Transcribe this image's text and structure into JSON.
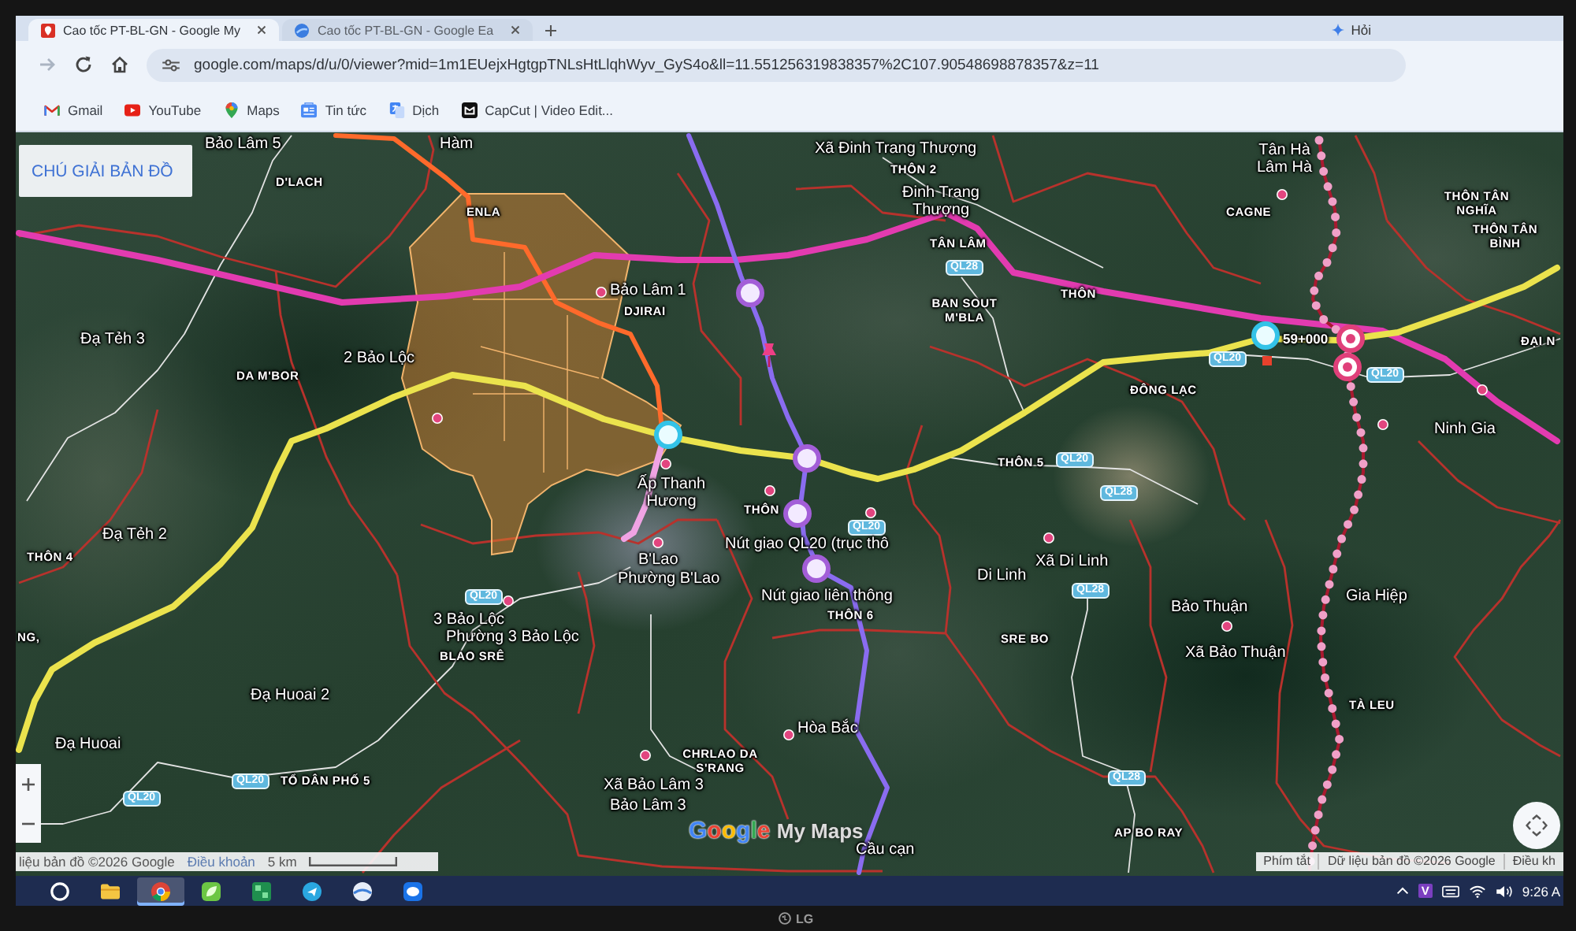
{
  "browser": {
    "tabs": [
      {
        "title": "Cao tốc PT-BL-GN - Google My",
        "selected": true
      },
      {
        "title": "Cao tốc PT-BL-GN - Google Ea",
        "selected": false
      }
    ],
    "assistant_button": "Hỏi",
    "forward_button": {
      "disabled": true
    },
    "url": "google.com/maps/d/u/0/viewer?mid=1m1EUejxHgtgpTNLsHtLlqhWyv_GyS4o&ll=11.551256319838357%2C107.90548698878357&z=11",
    "bookmarks": [
      {
        "label": "Gmail",
        "kind": "gmail"
      },
      {
        "label": "YouTube",
        "kind": "youtube"
      },
      {
        "label": "Maps",
        "kind": "maps"
      },
      {
        "label": "Tin tức",
        "kind": "news"
      },
      {
        "label": "Dịch",
        "kind": "translate"
      },
      {
        "label": "CapCut | Video Edit...",
        "kind": "capcut"
      }
    ]
  },
  "map": {
    "legend_button": "CHÚ GIẢI BẢN ĐỒ",
    "labels": [
      {
        "text": "Bảo Lâm 5",
        "kind": "place"
      },
      {
        "text": "Hàm",
        "kind": "place"
      },
      {
        "text": "Xã Đinh Trang Thượng",
        "kind": "place"
      },
      {
        "text": "THÔN 2",
        "kind": "hamlet"
      },
      {
        "text": "Tân Hà Lâm Hà",
        "kind": "place"
      },
      {
        "text": "D'LACH",
        "kind": "hamlet"
      },
      {
        "text": "ENLA",
        "kind": "hamlet"
      },
      {
        "text": "Đinh Trang Thượng",
        "kind": "place"
      },
      {
        "text": "CAGNE",
        "kind": "hamlet"
      },
      {
        "text": "THÔN TÂN NGHĨA",
        "kind": "hamlet"
      },
      {
        "text": "TÂN LÂM",
        "kind": "hamlet"
      },
      {
        "text": "THÔN TÂN BÌNH",
        "kind": "hamlet"
      },
      {
        "text": "QL28",
        "kind": "road"
      },
      {
        "text": "Bảo Lâm 1",
        "kind": "place"
      },
      {
        "text": "THÔN",
        "kind": "hamlet"
      },
      {
        "text": "DJIRAI",
        "kind": "hamlet"
      },
      {
        "text": "BAN SOUT M'BLA",
        "kind": "hamlet"
      },
      {
        "text": "Đạ Tẻh 3",
        "kind": "place"
      },
      {
        "text": "59+000",
        "kind": "km"
      },
      {
        "text": "ĐẠI N",
        "kind": "hamlet"
      },
      {
        "text": "2 Bảo Lộc",
        "kind": "place"
      },
      {
        "text": "QL20",
        "kind": "road"
      },
      {
        "text": "DA M'BOR",
        "kind": "hamlet"
      },
      {
        "text": "QL20",
        "kind": "road"
      },
      {
        "text": "ĐÔNG LẠC",
        "kind": "hamlet"
      },
      {
        "text": "Ninh Gia",
        "kind": "place"
      },
      {
        "text": "THÔN 5",
        "kind": "hamlet"
      },
      {
        "text": "QL20",
        "kind": "road"
      },
      {
        "text": "Ấp Thanh Hương",
        "kind": "place"
      },
      {
        "text": "QL28",
        "kind": "road"
      },
      {
        "text": "THÔN",
        "kind": "hamlet"
      },
      {
        "text": "Đạ Tẻh 2",
        "kind": "place"
      },
      {
        "text": "QL20",
        "kind": "road"
      },
      {
        "text": "Nút giao QL20 (trục thô",
        "kind": "place"
      },
      {
        "text": "THÔN 4",
        "kind": "hamlet"
      },
      {
        "text": "B'Lao",
        "kind": "place"
      },
      {
        "text": "Xã Di Linh",
        "kind": "place"
      },
      {
        "text": "Phường B'Lao",
        "kind": "place"
      },
      {
        "text": "Di Linh",
        "kind": "place"
      },
      {
        "text": "QL20",
        "kind": "road"
      },
      {
        "text": "Nút giao liên thông",
        "kind": "place"
      },
      {
        "text": "QL28",
        "kind": "road"
      },
      {
        "text": "Gia Hiệp",
        "kind": "place"
      },
      {
        "text": "THÔN 6",
        "kind": "hamlet"
      },
      {
        "text": "Bảo Thuận",
        "kind": "place"
      },
      {
        "text": "3 Bảo Lộc",
        "kind": "place"
      },
      {
        "text": "NG,",
        "kind": "hamlet"
      },
      {
        "text": "Phường 3 Bảo Lộc",
        "kind": "place"
      },
      {
        "text": "SRE BO",
        "kind": "hamlet"
      },
      {
        "text": "BLAO SRÊ",
        "kind": "hamlet"
      },
      {
        "text": "Xã Bảo Thuận",
        "kind": "place"
      },
      {
        "text": "Đạ Huoai 2",
        "kind": "place"
      },
      {
        "text": "TÀ LEU",
        "kind": "hamlet"
      },
      {
        "text": "Hòa Bắc",
        "kind": "place"
      },
      {
        "text": "Đạ Huoai",
        "kind": "place"
      },
      {
        "text": "CHRLAO DA S'RANG",
        "kind": "hamlet"
      },
      {
        "text": "QL20",
        "kind": "road"
      },
      {
        "text": "TỔ DÂN PHỐ 5",
        "kind": "hamlet"
      },
      {
        "text": "Xã Bảo Lâm 3",
        "kind": "place"
      },
      {
        "text": "QL28",
        "kind": "road"
      },
      {
        "text": "QL20",
        "kind": "road"
      },
      {
        "text": "Bảo Lâm 3",
        "kind": "place"
      },
      {
        "text": "AP BO RAY",
        "kind": "hamlet"
      },
      {
        "text": "Cầu cạn",
        "kind": "place"
      }
    ],
    "logo": {
      "brand": "Google",
      "product": "My Maps"
    },
    "attribution": {
      "data": "liệu bản đồ ©2026 Google",
      "terms": "Điều khoản",
      "scale": "5 km"
    },
    "footer_links": [
      "Phím tắt",
      "Dữ liệu bản đồ ©2026 Google",
      "Điều kh"
    ]
  },
  "taskbar": {
    "apps": [
      {
        "kind": "search",
        "selected": false
      },
      {
        "kind": "folder",
        "selected": false
      },
      {
        "kind": "chrome",
        "selected": true
      },
      {
        "kind": "leaf",
        "selected": false
      },
      {
        "kind": "grid",
        "selected": false
      },
      {
        "kind": "circle",
        "selected": false
      },
      {
        "kind": "globe",
        "selected": false
      },
      {
        "kind": "chat",
        "selected": false
      }
    ],
    "input_method": "V",
    "clock": "9:26 A"
  },
  "tv": {
    "brand": "LG"
  }
}
